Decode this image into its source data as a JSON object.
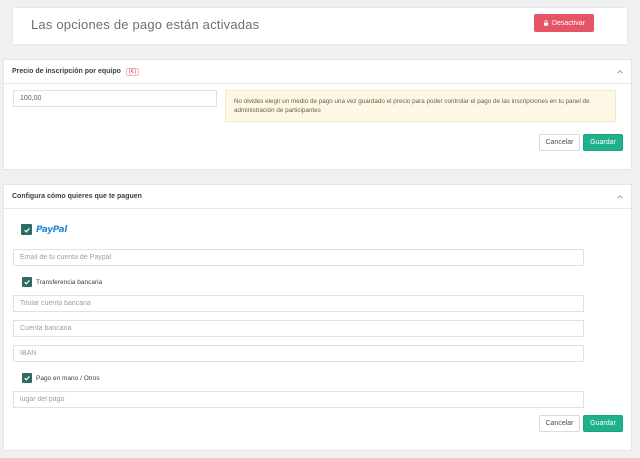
{
  "status": {
    "text": "Las opciones de pago están activadas",
    "deactivate_label": "Desactivar",
    "deactivate_color": "#e65566"
  },
  "registration": {
    "title": "Precio de inscripción por equipo",
    "currency": "(€)",
    "price_value": "100,00",
    "notice": "No olvides elegir un medio de pago una vez guardado el precio para poder controlar el pago de las inscripciones en tu panel de administración de participantes",
    "cancel_label": "Cancelar",
    "save_label": "Guardar"
  },
  "payment": {
    "title": "Configura cómo quieres que te paguen",
    "paypal": {
      "checked": true,
      "logo_text_1": "Pay",
      "logo_text_2": "Pal",
      "email_placeholder": "Email de tu cuenta de Paypal"
    },
    "transfer": {
      "checked": true,
      "label": "Transferencia bancaria",
      "holder_placeholder": "Titular cuenta bancaria",
      "account_placeholder": "Cuenta bancaria",
      "iban_placeholder": "IBAN"
    },
    "cash": {
      "checked": true,
      "label": "Pago en mano / Otros",
      "place_placeholder": "lugar del pago"
    },
    "cancel_label": "Cancelar",
    "save_label": "Guardar"
  },
  "colors": {
    "accent_green": "#1fb08c",
    "checkbox": "#2d6b63",
    "danger": "#e65566"
  },
  "icons": {
    "lock": "lock-icon",
    "chevron": "chevron-up-icon",
    "check": "check-icon"
  }
}
